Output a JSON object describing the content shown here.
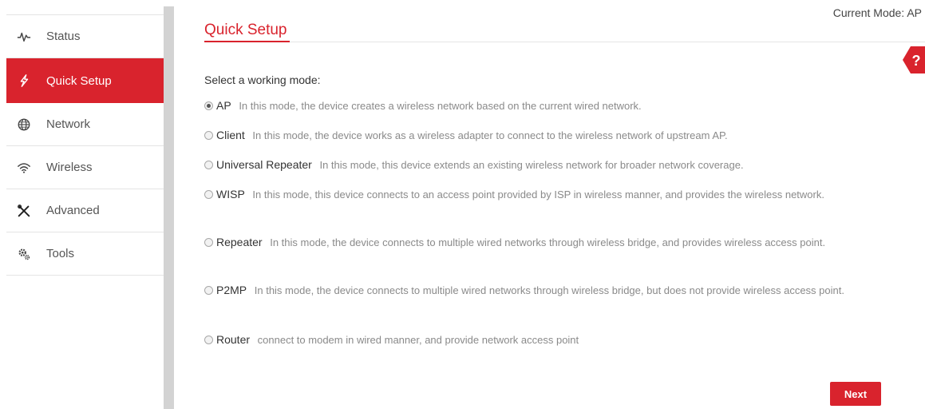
{
  "header": {
    "current_mode": "Current Mode: AP",
    "title": "Quick Setup",
    "help_label": "?"
  },
  "sidebar": {
    "items": [
      {
        "label": "Status",
        "icon": "pulse-icon",
        "active": false
      },
      {
        "label": "Quick Setup",
        "icon": "lightning-icon",
        "active": true
      },
      {
        "label": "Network",
        "icon": "globe-icon",
        "active": false
      },
      {
        "label": "Wireless",
        "icon": "wifi-icon",
        "active": false
      },
      {
        "label": "Advanced",
        "icon": "tools-cross-icon",
        "active": false
      },
      {
        "label": "Tools",
        "icon": "gears-icon",
        "active": false
      }
    ]
  },
  "content": {
    "prompt": "Select a working mode:",
    "selected_mode": "AP",
    "modes": [
      {
        "name": "AP",
        "desc": "In this mode, the device creates a wireless network based on the current wired network."
      },
      {
        "name": "Client",
        "desc": "In this mode, the device works as a wireless adapter to connect to the wireless network of upstream AP."
      },
      {
        "name": "Universal Repeater",
        "desc": "In this mode, this device extends an existing wireless network for broader network coverage."
      },
      {
        "name": "WISP",
        "desc": "In this mode, this device connects to an access point provided by ISP in wireless manner, and provides the wireless network."
      },
      {
        "name": "Repeater",
        "desc": "In this mode, the device connects to multiple wired networks through wireless bridge, and provides wireless access point."
      },
      {
        "name": "P2MP",
        "desc": "In this mode, the device connects to multiple wired networks through wireless bridge, but does not provide wireless access point."
      },
      {
        "name": "Router",
        "desc": "connect to modem in wired manner, and provide network access point"
      }
    ],
    "next_label": "Next"
  },
  "colors": {
    "accent": "#d9232d",
    "sidebar_text": "#555555",
    "splitter": "#d3d3d3"
  }
}
